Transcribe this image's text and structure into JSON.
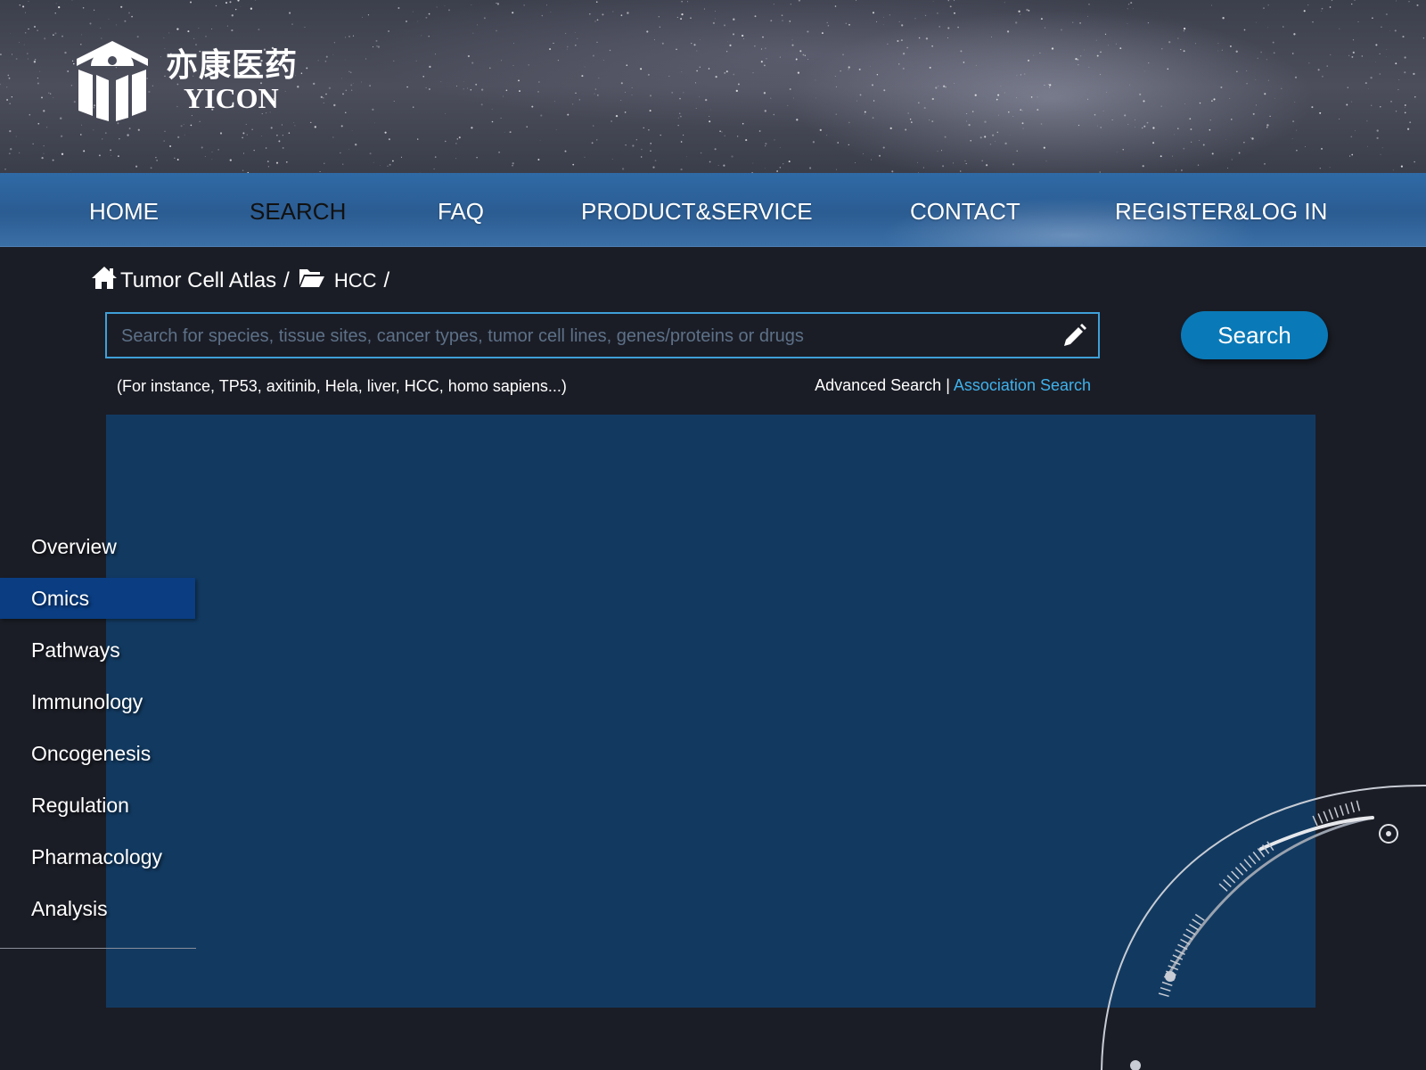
{
  "brand": {
    "name_cn": "亦康医药",
    "name_en": "YICON"
  },
  "nav": {
    "items": [
      {
        "label": "HOME",
        "active": false
      },
      {
        "label": "SEARCH",
        "active": true
      },
      {
        "label": "FAQ",
        "active": false
      },
      {
        "label": "PRODUCT&SERVICE",
        "active": false
      },
      {
        "label": "CONTACT",
        "active": false
      },
      {
        "label": "REGISTER&LOG IN",
        "active": false
      }
    ]
  },
  "breadcrumb": {
    "items": [
      {
        "label": "Tumor Cell Atlas",
        "icon": "home-icon"
      },
      {
        "label": "HCC",
        "icon": "folder-open-icon"
      }
    ],
    "separator": "/"
  },
  "search": {
    "placeholder": "Search for species, tissue sites, cancer types, tumor cell lines, genes/proteins or drugs",
    "value": "",
    "button_label": "Search",
    "hint": "(For instance, TP53, axitinib, Hela, liver, HCC, homo sapiens...)",
    "advanced_label": "Advanced Search",
    "divider": "|",
    "association_label": "Association Search"
  },
  "sidebar": {
    "items": [
      {
        "label": "Overview",
        "active": false
      },
      {
        "label": "Omics",
        "active": true
      },
      {
        "label": "Pathways",
        "active": false
      },
      {
        "label": "Immunology",
        "active": false
      },
      {
        "label": "Oncogenesis",
        "active": false
      },
      {
        "label": "Regulation",
        "active": false
      },
      {
        "label": "Pharmacology",
        "active": false
      },
      {
        "label": "Analysis",
        "active": false
      }
    ]
  },
  "colors": {
    "page_bg": "#1b1d26",
    "nav_bg": "#2b5c92",
    "panel_bg": "#123a61",
    "accent": "#0a79b7",
    "link": "#3fb2ec",
    "sidebar_active": "#0a3d82"
  }
}
